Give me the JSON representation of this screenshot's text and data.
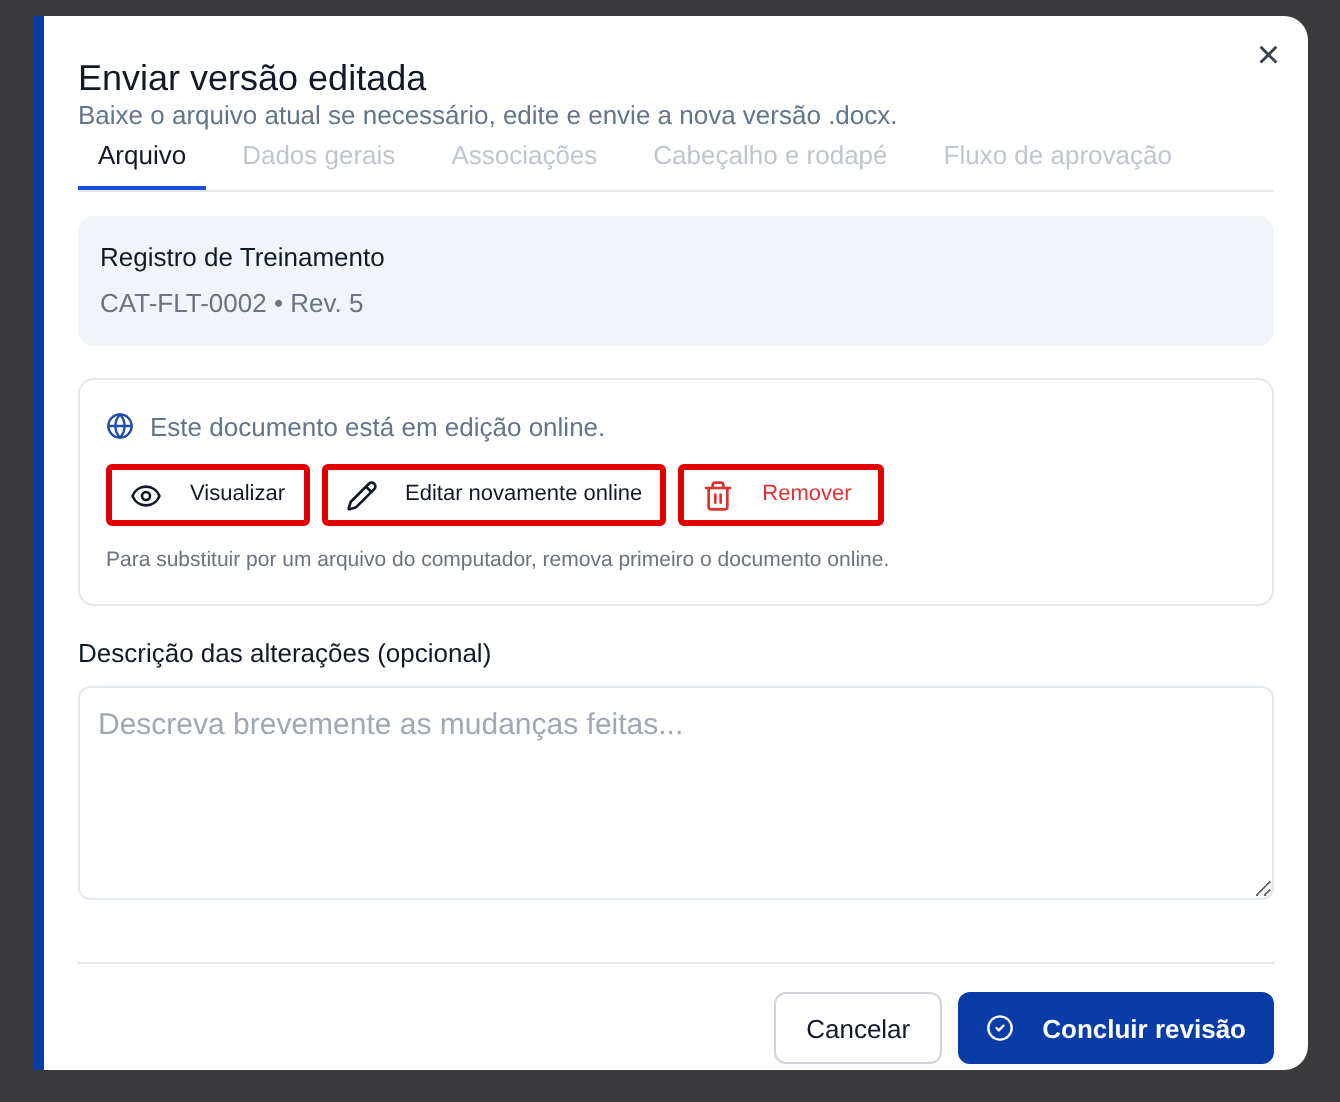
{
  "dialog": {
    "title": "Enviar versão editada",
    "subtitle": "Baixe o arquivo atual se necessário, edite e envie a nova versão .docx.",
    "close": "×"
  },
  "tabs": [
    {
      "label": "Arquivo",
      "selected": true
    },
    {
      "label": "Dados gerais",
      "selected": false
    },
    {
      "label": "Associações",
      "selected": false
    },
    {
      "label": "Cabeçalho e rodapé",
      "selected": false
    },
    {
      "label": "Fluxo de aprovação",
      "selected": false
    }
  ],
  "document": {
    "name": "Registro de Treinamento",
    "meta": "CAT-FLT-0002 • Rev. 5"
  },
  "online": {
    "status": "Este documento está em edição online.",
    "hint": "Para substituir por um arquivo do computador, remova primeiro o documento online.",
    "actions": [
      {
        "kind": "view",
        "label": "Visualizar",
        "highlighted": true
      },
      {
        "kind": "edit",
        "label": "Editar novamente online",
        "highlighted": true
      },
      {
        "kind": "remove",
        "label": "Remover",
        "highlighted": true
      }
    ]
  },
  "description": {
    "label": "Descrição das alterações (opcional)",
    "placeholder": "Descreva brevemente as mudanças feitas..."
  },
  "footer": {
    "cancel": "Cancelar",
    "confirm": "Concluir revisão"
  }
}
